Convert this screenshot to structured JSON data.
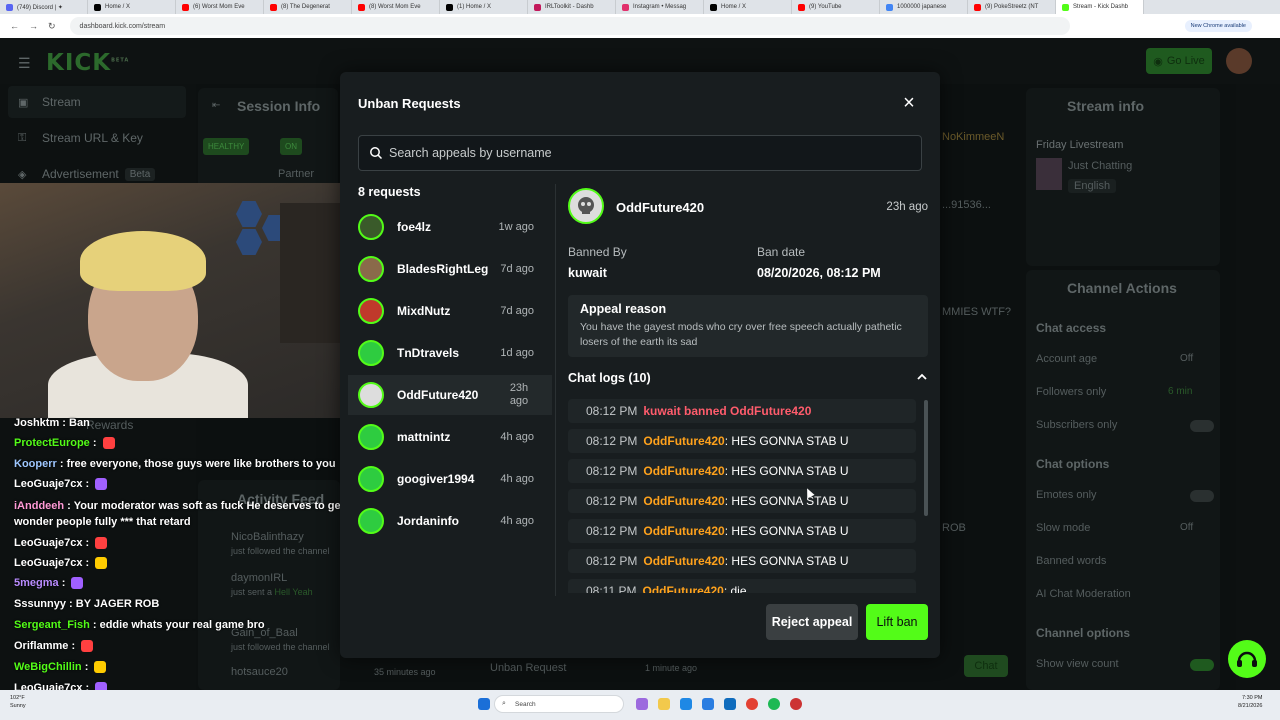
{
  "browser": {
    "tabs": [
      {
        "label": "(749) Discord | ✦",
        "color": "#5865f2"
      },
      {
        "label": "Home / X",
        "color": "#000000"
      },
      {
        "label": "(6) Worst Mom Eve",
        "color": "#ff0000"
      },
      {
        "label": "(8) The Degenerat",
        "color": "#ff0000"
      },
      {
        "label": "(8) Worst Mom Eve",
        "color": "#ff0000"
      },
      {
        "label": "(1) Home / X",
        "color": "#000000"
      },
      {
        "label": "IRLToolkit - Dashb",
        "color": "#c2185b"
      },
      {
        "label": "Instagram • Messag",
        "color": "#e1306c"
      },
      {
        "label": "Home / X",
        "color": "#000000"
      },
      {
        "label": "(9) YouTube",
        "color": "#ff0000"
      },
      {
        "label": "1000000 japanese",
        "color": "#4285f4"
      },
      {
        "label": "(9) PokeStreetz (NT",
        "color": "#ff0000"
      },
      {
        "label": "Stream - Kick Dashb",
        "color": "#53fc18"
      }
    ],
    "url": "dashboard.kick.com/stream",
    "update_label": "New Chrome available"
  },
  "app": {
    "logo": "KICK",
    "logo_sup": "BETA",
    "go_live": "Go Live",
    "sidebar": [
      {
        "label": "Stream",
        "icon": "stream-icon"
      },
      {
        "label": "Stream URL & Key",
        "icon": "key-icon"
      },
      {
        "label": "Advertisement",
        "badge": "Beta",
        "icon": "megaphone-icon"
      }
    ],
    "session_info": {
      "title": "Session Info",
      "healthy": "HEALTHY",
      "on": "ON",
      "session": "Session",
      "partner": "Partner"
    },
    "rewards": "Rewards",
    "activity_feed": {
      "title": "Activity Feed",
      "items": [
        {
          "name": "NicoBalinthazy",
          "text": "just followed the channel"
        },
        {
          "name": "daymonIRL",
          "text": "just sent a",
          "extra": "Hell Yeah"
        },
        {
          "name": "Gain_of_Baal",
          "text": "just followed the channel"
        },
        {
          "name": "hotsauce20",
          "text": "35 minutes ago"
        }
      ],
      "unban_request": "Unban Request",
      "unban_time": "1 minute ago"
    },
    "chat_mid": {
      "user": "NoKimmeeN",
      "line1": "...91536...",
      "line2": "MMIES WTF?",
      "line3": "ROB",
      "send": "Chat"
    },
    "stream_info": {
      "title": "Stream info",
      "name": "Friday Livestream",
      "category": "Just Chatting",
      "language": "English"
    },
    "channel_actions": {
      "title": "Channel Actions",
      "chat_access": "Chat access",
      "account_age": "Account age",
      "account_age_val": "Off",
      "followers_only": "Followers only",
      "followers_only_val": "6 min",
      "subscribers_only": "Subscribers only",
      "chat_options": "Chat options",
      "emotes_only": "Emotes only",
      "slow_mode": "Slow mode",
      "slow_mode_val": "Off",
      "banned_words": "Banned words",
      "ai_moderation": "AI Chat Moderation",
      "channel_options": "Channel options",
      "show_view_count": "Show view count"
    }
  },
  "stream_chat": [
    {
      "user": "Joshktm",
      "color": "#ffffff",
      "text": "Ban"
    },
    {
      "user": "ProtectEurope",
      "color": "#53fc18",
      "text": ""
    },
    {
      "user": "Kooperr",
      "color": "#9ec7ff",
      "text": "free everyone, those guys were like brothers to you"
    },
    {
      "user": "LeoGuaje7cx",
      "color": "#ffffff",
      "text": ""
    },
    {
      "user": "iAnddeeh",
      "color": "#ff9ad6",
      "text": "Your moderator was soft as fuck He deserves to get beheaded No"
    },
    {
      "user": "",
      "color": "#ffffff",
      "text": "wonder people fully *** that retard"
    },
    {
      "user": "LeoGuaje7cx",
      "color": "#ffffff",
      "text": ""
    },
    {
      "user": "LeoGuaje7cx",
      "color": "#ffffff",
      "text": ""
    },
    {
      "user": "5megma",
      "color": "#b98cff",
      "text": ""
    },
    {
      "user": "Sssunnyy",
      "color": "#ffffff",
      "text": "BY JAGER ROB"
    },
    {
      "user": "Sergeant_Fish",
      "color": "#53fc18",
      "text": "eddie whats your real game bro"
    },
    {
      "user": "Oriflamme",
      "color": "#ffffff",
      "text": ""
    },
    {
      "user": "WeBigChillin",
      "color": "#53fc18",
      "text": ""
    },
    {
      "user": "LeoGuaje7cx",
      "color": "#ffffff",
      "text": ""
    }
  ],
  "modal": {
    "title": "Unban Requests",
    "search_placeholder": "Search appeals by username",
    "request_count": "8 requests",
    "requests": [
      {
        "name": "foe4lz",
        "time": "1w ago",
        "avatar_color": "#3a5a2a"
      },
      {
        "name": "BladesRightLeg",
        "time": "7d ago",
        "avatar_color": "#8a6a4a"
      },
      {
        "name": "MixdNutz",
        "time": "7d ago",
        "avatar_color": "#c0392b"
      },
      {
        "name": "TnDtravels",
        "time": "1d ago",
        "avatar_color": "#2ecc40"
      },
      {
        "name": "OddFuture420",
        "time": "23h ago",
        "avatar_color": "#dddddd",
        "selected": true
      },
      {
        "name": "mattnintz",
        "time": "4h ago",
        "avatar_color": "#2ecc40"
      },
      {
        "name": "googiver1994",
        "time": "4h ago",
        "avatar_color": "#2ecc40"
      },
      {
        "name": "Jordaninfo",
        "time": "4h ago",
        "avatar_color": "#2ecc40"
      }
    ],
    "detail": {
      "name": "OddFuture420",
      "time": "23h ago",
      "banned_by_label": "Banned By",
      "banned_by": "kuwait",
      "ban_date_label": "Ban date",
      "ban_date": "08/20/2026, 08:12 PM",
      "appeal_label": "Appeal reason",
      "appeal_text": "You have the gayest mods who cry over free speech actually pathetic losers of the earth its sad",
      "logs_label": "Chat logs (10)",
      "logs": [
        {
          "time": "08:12 PM",
          "type": "ban",
          "text": "kuwait banned OddFuture420"
        },
        {
          "time": "08:12 PM",
          "type": "msg",
          "user": "OddFuture420",
          "text": ": HES GONNA STAB U"
        },
        {
          "time": "08:12 PM",
          "type": "msg",
          "user": "OddFuture420",
          "text": ": HES GONNA STAB U"
        },
        {
          "time": "08:12 PM",
          "type": "msg",
          "user": "OddFuture420",
          "text": ": HES GONNA STAB U"
        },
        {
          "time": "08:12 PM",
          "type": "msg",
          "user": "OddFuture420",
          "text": ": HES GONNA STAB U"
        },
        {
          "time": "08:12 PM",
          "type": "msg",
          "user": "OddFuture420",
          "text": ": HES GONNA STAB U"
        },
        {
          "time": "08:11 PM",
          "type": "msg",
          "user": "OddFuture420",
          "text": ": die"
        }
      ]
    },
    "reject_label": "Reject appeal",
    "lift_label": "Lift ban"
  },
  "taskbar": {
    "search": "Search",
    "time": "7:30 PM",
    "date": "8/21/2026",
    "weather_temp": "102°F",
    "weather_desc": "Sunny"
  }
}
